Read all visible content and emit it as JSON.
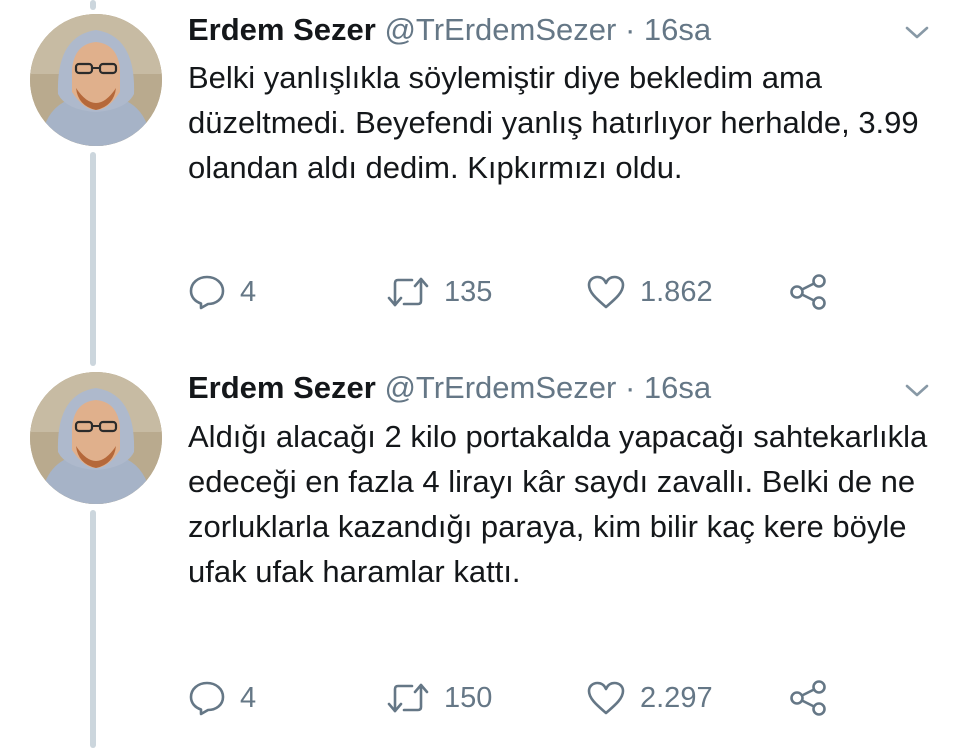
{
  "colors": {
    "text": "#14171a",
    "secondary": "#657786",
    "thread_line": "#ccd6dd",
    "background": "#ffffff"
  },
  "tweets": [
    {
      "author_name": "Erdem Sezer",
      "handle": "@TrErdemSezer",
      "separator": "·",
      "time": "16sa",
      "text": "Belki yanlışlıkla söylemiştir diye bekledim ama düzeltmedi. Beyefendi yanlış hatırlıyor herhalde, 3.99 olandan aldı dedim. Kıpkırmızı oldu.",
      "replies": "4",
      "retweets": "135",
      "likes": "1.862",
      "icons": [
        "reply-icon",
        "retweet-icon",
        "like-icon",
        "share-icon"
      ]
    },
    {
      "author_name": "Erdem Sezer",
      "handle": "@TrErdemSezer",
      "separator": "·",
      "time": "16sa",
      "text": "Aldığı alacağı 2 kilo portakalda yapacağı sahtekarlıkla edeceği en fazla 4 lirayı kâr saydı zavallı. Belki de ne zorluklarla kazandığı paraya, kim bilir kaç kere böyle ufak ufak haramlar kattı.",
      "replies": "4",
      "retweets": "150",
      "likes": "2.297",
      "icons": [
        "reply-icon",
        "retweet-icon",
        "like-icon",
        "share-icon"
      ]
    }
  ]
}
